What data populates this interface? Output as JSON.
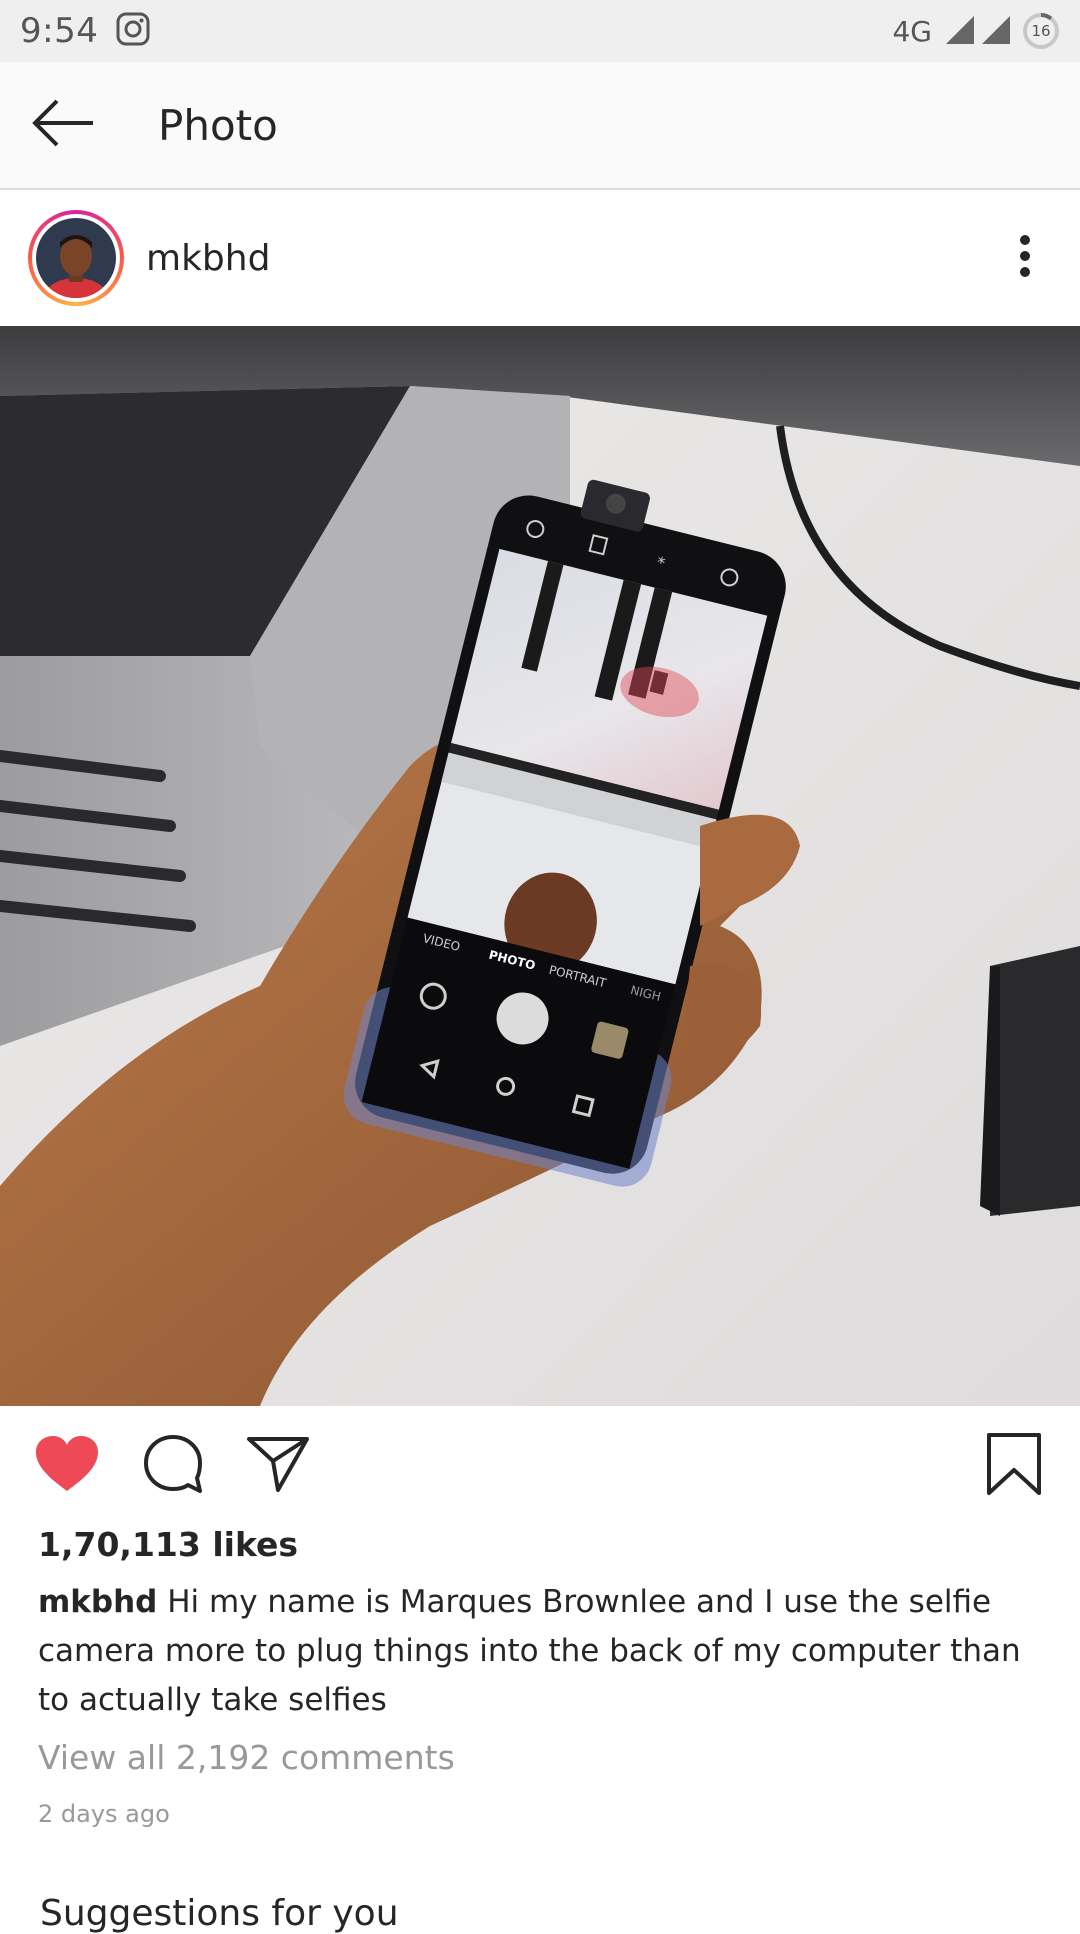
{
  "status_bar": {
    "time": "9:54",
    "network": "4G",
    "battery": "16"
  },
  "app_bar": {
    "title": "Photo"
  },
  "post": {
    "username": "mkbhd",
    "likes": "1,70,113 likes",
    "caption_user": "mkbhd",
    "caption_text": " Hi my name is Marques Brownlee and I use the selfie camera more to plug things into the back of my computer than to actually take selfies",
    "view_comments": "View all 2,192 comments",
    "time_ago": "2 days ago",
    "liked": true,
    "photo_screen_labels": {
      "video": "VIDEO",
      "photo": "PHOTO",
      "portrait": "PORTRAIT",
      "night": "NIGH"
    }
  },
  "suggestions": {
    "title": "Suggestions for you"
  },
  "colors": {
    "like_red": "#ed4956",
    "status_bg": "#efefef",
    "app_bar_bg": "#fafafa",
    "muted_text": "#999999"
  },
  "icons": {
    "status": [
      "instagram-icon",
      "signal-icon",
      "battery-icon"
    ],
    "app_bar": [
      "back-arrow-icon"
    ],
    "post_header": [
      "more-options-icon"
    ],
    "actions": [
      "heart-icon",
      "comment-icon",
      "share-icon",
      "bookmark-icon"
    ]
  }
}
